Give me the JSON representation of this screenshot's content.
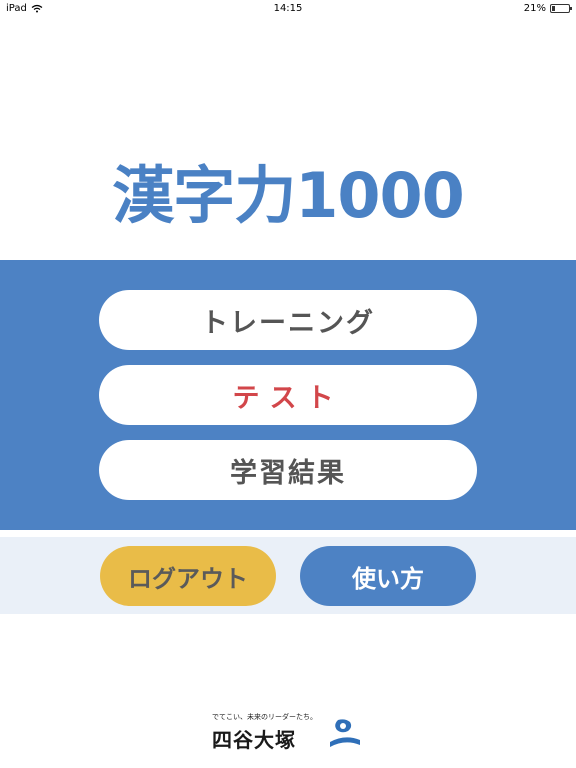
{
  "status_bar": {
    "device": "iPad",
    "time": "14:15",
    "battery": "21%",
    "battery_level": 0.21
  },
  "app": {
    "title": "漢字力1000"
  },
  "menu": {
    "training": "トレーニング",
    "test": "テスト",
    "results": "学習結果"
  },
  "footer_actions": {
    "logout": "ログアウト",
    "how_to_use": "使い方"
  },
  "logo": {
    "tagline": "でてこい、未来のリーダーたち。",
    "name": "四谷大塚"
  },
  "colors": {
    "brand_blue": "#4d82c4",
    "test_red": "#d2464a",
    "logout_yellow": "#e9bc48"
  }
}
